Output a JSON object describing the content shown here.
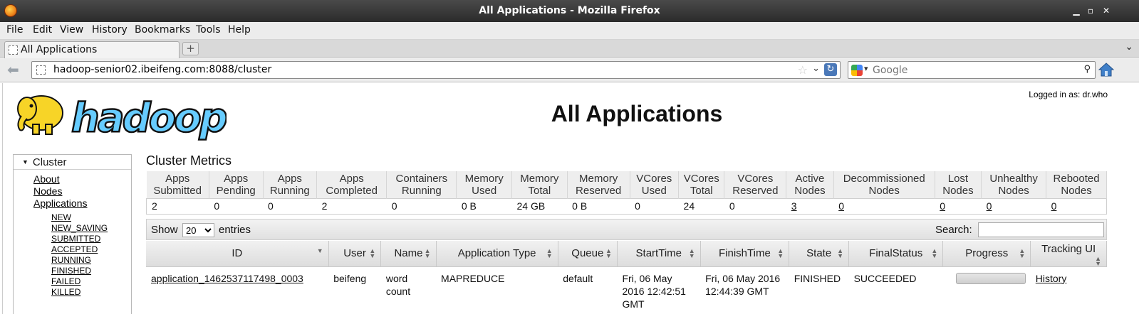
{
  "window": {
    "title": "All Applications - Mozilla Firefox",
    "controls": {
      "minimize": "▁",
      "maximize": "▫",
      "close": "✕"
    }
  },
  "menu": [
    "File",
    "Edit",
    "View",
    "History",
    "Bookmarks",
    "Tools",
    "Help"
  ],
  "tabs": [
    {
      "label": "All Applications"
    }
  ],
  "newtab_label": "+",
  "tablist_label": "⌄",
  "nav": {
    "back_label": "⬅",
    "url": "hadoop-senior02.ibeifeng.com:8088/cluster",
    "star_label": "☆",
    "url_dropdown_label": "⌄",
    "reload_label": "↻",
    "search_placeholder": "Google",
    "search_dropdown_label": "▾",
    "search_go_label": "⚲"
  },
  "page": {
    "logged_in": "Logged in as: dr.who",
    "title": "All Applications"
  },
  "sidebar": {
    "header": "Cluster",
    "header_toggle": "▼",
    "links": [
      "About",
      "Nodes",
      "Applications"
    ],
    "states": [
      "NEW",
      "NEW_SAVING",
      "SUBMITTED",
      "ACCEPTED",
      "RUNNING",
      "FINISHED",
      "FAILED",
      "KILLED"
    ]
  },
  "metrics": {
    "title": "Cluster Metrics",
    "headers": [
      "Apps Submitted",
      "Apps Pending",
      "Apps Running",
      "Apps Completed",
      "Containers Running",
      "Memory Used",
      "Memory Total",
      "Memory Reserved",
      "VCores Used",
      "VCores Total",
      "VCores Reserved",
      "Active Nodes",
      "Decommissioned Nodes",
      "Lost Nodes",
      "Unhealthy Nodes",
      "Rebooted Nodes"
    ],
    "values": [
      "2",
      "0",
      "0",
      "2",
      "0",
      "0 B",
      "24 GB",
      "0 B",
      "0",
      "24",
      "0",
      "3",
      "0",
      "0",
      "0",
      "0"
    ]
  },
  "table_controls": {
    "show_label": "Show",
    "entries_value": "20",
    "entries_label": "entries",
    "search_label": "Search:"
  },
  "apps": {
    "headers": [
      "ID",
      "User",
      "Name",
      "Application Type",
      "Queue",
      "StartTime",
      "FinishTime",
      "State",
      "FinalStatus",
      "Progress",
      "Tracking UI"
    ],
    "rows": [
      {
        "id": "application_1462537117498_0003",
        "user": "beifeng",
        "name": "word count",
        "type": "MAPREDUCE",
        "queue": "default",
        "start": "Fri, 06 May 2016 12:42:51 GMT",
        "finish": "Fri, 06 May 2016 12:44:39 GMT",
        "state": "FINISHED",
        "final_status": "SUCCEEDED",
        "progress": 1.0,
        "tracking": "History"
      }
    ]
  },
  "colors": {
    "titlebar": "#2b2b2b",
    "logo_yellow": "#f7d427",
    "logo_blue": "#66ccff",
    "reload_blue": "#4a78b8"
  }
}
